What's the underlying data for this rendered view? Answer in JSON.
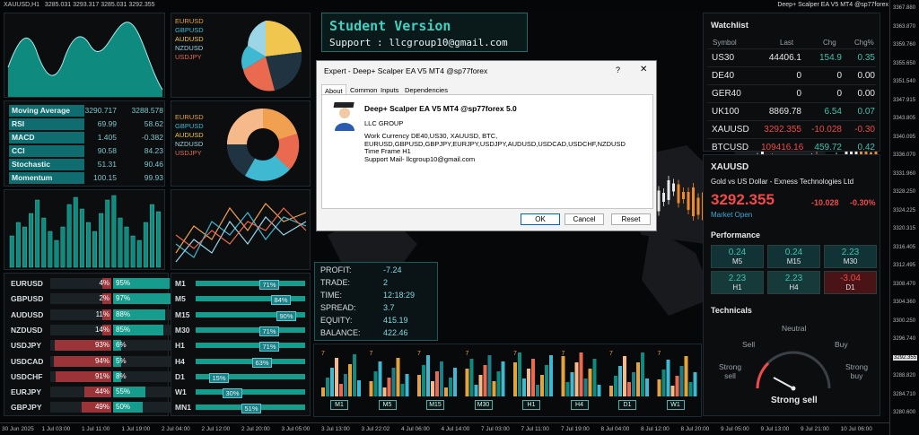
{
  "topbar": {
    "symbol": "XAUUSD,H1",
    "ohlc": "3285.031 3293.317 3285.031 3292.355",
    "title": "Deep+ Scalper EA V5 MT4 @sp77forex"
  },
  "student": {
    "title": "Student Version",
    "support": "Support : llcgroup10@gmail.com"
  },
  "legend1": [
    {
      "name": "EURUSD",
      "color": "#e6a33b"
    },
    {
      "name": "GBPUSD",
      "color": "#3fb8d2"
    },
    {
      "name": "AUDUSD",
      "color": "#f0c64e"
    },
    {
      "name": "NZDUSD",
      "color": "#9bd5e6"
    },
    {
      "name": "USDJPY",
      "color": "#e96a4f"
    }
  ],
  "legend2": [
    {
      "name": "EURUSD",
      "color": "#e6a33b"
    },
    {
      "name": "GBPUSD",
      "color": "#3fb8d2"
    },
    {
      "name": "AUDUSD",
      "color": "#f0c64e"
    },
    {
      "name": "NZDUSD",
      "color": "#9bd5e6"
    },
    {
      "name": "USDJPY",
      "color": "#e96a4f"
    }
  ],
  "indicators": [
    {
      "name": "Moving Average",
      "v1": "3290.717",
      "v2": "3288.578"
    },
    {
      "name": "RSI",
      "v1": "69.99",
      "v2": "58.62"
    },
    {
      "name": "MACD",
      "v1": "1.405",
      "v2": "-0.382"
    },
    {
      "name": "CCI",
      "v1": "90.58",
      "v2": "84.23"
    },
    {
      "name": "Stochastic",
      "v1": "51.31",
      "v2": "90.46"
    },
    {
      "name": "Momentum",
      "v1": "100.15",
      "v2": "99.93"
    }
  ],
  "strength": [
    {
      "sym": "EURUSD",
      "sell": "4%",
      "buy": "95%",
      "sv": 4,
      "bv": 95
    },
    {
      "sym": "GBPUSD",
      "sell": "2%",
      "buy": "97%",
      "sv": 2,
      "bv": 97
    },
    {
      "sym": "AUDUSD",
      "sell": "11%",
      "buy": "88%",
      "sv": 11,
      "bv": 88
    },
    {
      "sym": "NZDUSD",
      "sell": "14%",
      "buy": "85%",
      "sv": 14,
      "bv": 85
    },
    {
      "sym": "USDJPY",
      "sell": "93%",
      "buy": "6%",
      "sv": 93,
      "bv": 6
    },
    {
      "sym": "USDCAD",
      "sell": "94%",
      "buy": "5%",
      "sv": 94,
      "bv": 5
    },
    {
      "sym": "USDCHF",
      "sell": "91%",
      "buy": "8%",
      "sv": 91,
      "bv": 8
    },
    {
      "sym": "EURJPY",
      "sell": "44%",
      "buy": "55%",
      "sv": 44,
      "bv": 55
    },
    {
      "sym": "GBPJPY",
      "sell": "49%",
      "buy": "50%",
      "sv": 49,
      "bv": 50
    }
  ],
  "timeframes": [
    {
      "tf": "M1",
      "pct": "71%",
      "v": 71
    },
    {
      "tf": "M5",
      "pct": "84%",
      "v": 84
    },
    {
      "tf": "M15",
      "pct": "90%",
      "v": 90
    },
    {
      "tf": "M30",
      "pct": "71%",
      "v": 71
    },
    {
      "tf": "H1",
      "pct": "71%",
      "v": 71
    },
    {
      "tf": "H4",
      "pct": "63%",
      "v": 63
    },
    {
      "tf": "D1",
      "pct": "15%",
      "v": 15
    },
    {
      "tf": "W1",
      "pct": "30%",
      "v": 30
    },
    {
      "tf": "MN1",
      "pct": "51%",
      "v": 51
    }
  ],
  "stats": [
    {
      "label": "PROFIT:",
      "value": "-7.24"
    },
    {
      "label": "TRADE:",
      "value": "2"
    },
    {
      "label": "TIME:",
      "value": "12:18:29"
    },
    {
      "label": "SPREAD:",
      "value": "3.7"
    },
    {
      "label": "EQUITY:",
      "value": "415.19"
    },
    {
      "label": "BALANCE:",
      "value": "422.46"
    }
  ],
  "dialog": {
    "title": "Expert - Deep+ Scalper EA V5 MT4 @sp77forex",
    "help": "?",
    "close": "✕",
    "tabs": [
      "About",
      "Common",
      "Inputs",
      "Dependencies"
    ],
    "name": "Deep+ Scalper EA V5 MT4 @sp77forex 5.0",
    "company": "LLC GROUP",
    "line1": "Work Currency DE40,US30, XAUUSD, BTC,",
    "line2": "EURUSD,GBPUSD,GBPJPY,EURJPY,USDJPY,AUDUSD,USDCAD,USDCHF,NZDUSD",
    "line3": "Time Frame H1",
    "line4": "Support Mail- llcgroup10@gmail.com",
    "ok": "OK",
    "cancel": "Cancel",
    "reset": "Reset"
  },
  "watchlist": {
    "title": "Watchlist",
    "headers": [
      "Symbol",
      "Last",
      "Chg",
      "Chg%"
    ],
    "rows": [
      {
        "sym": "US30",
        "last": "44406.1",
        "chg": "154.9",
        "pct": "0.35",
        "color": "#3fc1b0",
        "lastColor": "#e6e8ea"
      },
      {
        "sym": "DE40",
        "last": "0",
        "chg": "0",
        "pct": "0.00",
        "color": "#e6e8ea",
        "lastColor": "#e6e8ea"
      },
      {
        "sym": "GER40",
        "last": "0",
        "chg": "0",
        "pct": "0.00",
        "color": "#e6e8ea",
        "lastColor": "#e6e8ea"
      },
      {
        "sym": "UK100",
        "last": "8869.78",
        "chg": "6.54",
        "pct": "0.07",
        "color": "#3fc1b0",
        "lastColor": "#e6e8ea"
      },
      {
        "sym": "XAUUSD",
        "last": "3292.355",
        "chg": "-10.028",
        "pct": "-0.30",
        "color": "#f04a4a",
        "lastColor": "#f04a4a"
      },
      {
        "sym": "BTCUSD",
        "last": "109416.16",
        "chg": "459.72",
        "pct": "0.42",
        "color": "#3fc1b0",
        "lastColor": "#f04a4a"
      }
    ]
  },
  "quote": {
    "sym": "XAUUSD",
    "desc": "Gold vs US Dollar - Exness Technologies Ltd",
    "price": "3292.355",
    "chg": "-10.028",
    "pct": "-0.30%",
    "status": "Market Open"
  },
  "performance": {
    "title": "Performance",
    "boxes": [
      {
        "v": "0.24",
        "t": "M5",
        "bg": "#123336",
        "c": "#3fc1b0"
      },
      {
        "v": "0.24",
        "t": "M15",
        "bg": "#123336",
        "c": "#3fc1b0"
      },
      {
        "v": "2.23",
        "t": "M30",
        "bg": "#123336",
        "c": "#3fc1b0"
      },
      {
        "v": "2.23",
        "t": "H1",
        "bg": "#16393a",
        "c": "#3fc1b0"
      },
      {
        "v": "2.23",
        "t": "H4",
        "bg": "#16393a",
        "c": "#3fc1b0"
      },
      {
        "v": "-3.04",
        "t": "D1",
        "bg": "#4a1416",
        "c": "#f04a4a"
      }
    ]
  },
  "technicals": {
    "title": "Technicals",
    "neutral": "Neutral",
    "sell": "Sell",
    "buy": "Buy",
    "strong_sell": "Strong sell",
    "strong_sell_l": "Strong",
    "strong_sell_l2": "sell",
    "strong_buy_l": "Strong",
    "strong_buy_l2": "buy",
    "result": "Strong sell"
  },
  "price_axis": [
    "3367.880",
    "3363.870",
    "3359.760",
    "3355.650",
    "3351.540",
    "3347.915",
    "3343.805",
    "3340.095",
    "3336.070",
    "3331.960",
    "3328.250",
    "3324.225",
    "3320.315",
    "3316.405",
    "3312.495",
    "3308.470",
    "3304.360",
    "3300.250",
    "3296.740",
    "3292.355",
    "3288.820",
    "3284.710",
    "3280.600"
  ],
  "time_axis": [
    "30 Jun 2025",
    "1 Jul 03:00",
    "1 Jul 11:00",
    "1 Jul 19:00",
    "2 Jul 04:00",
    "2 Jul 12:00",
    "2 Jul 20:00",
    "3 Jul 05:00",
    "3 Jul 13:00",
    "3 Jul 22:02",
    "4 Jul 06:00",
    "4 Jul 14:00",
    "7 Jul 03:00",
    "7 Jul 11:00",
    "7 Jul 19:00",
    "8 Jul 04:00",
    "8 Jul 12:00",
    "8 Jul 20:00",
    "9 Jul 05:00",
    "9 Jul 13:00",
    "9 Jul 21:00",
    "10 Jul 06:00"
  ],
  "mini_tfs": [
    "M1",
    "M5",
    "M15",
    "M30",
    "H1",
    "H4",
    "D1",
    "W1"
  ],
  "mini_top": [
    "7",
    "7",
    "7",
    "7",
    "7",
    "7",
    "7",
    "7"
  ]
}
